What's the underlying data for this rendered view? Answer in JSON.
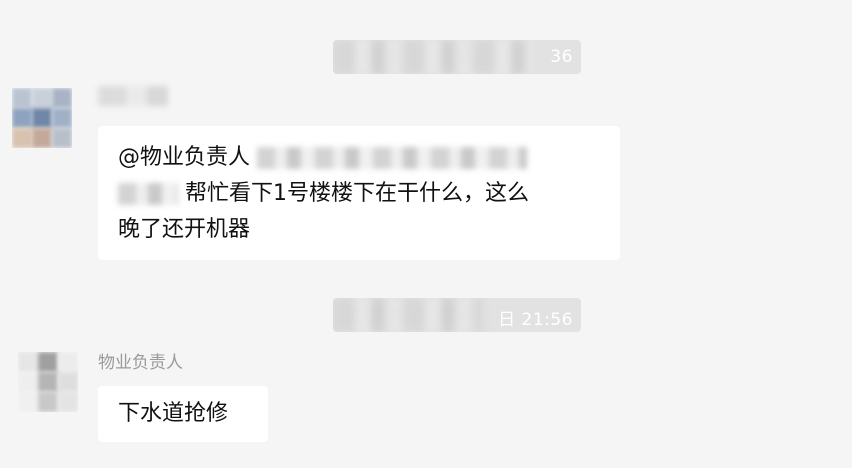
{
  "timestamps": [
    {
      "text": "36"
    },
    {
      "text": "日 21:56"
    }
  ],
  "messages": [
    {
      "sender": "",
      "line1_prefix": "@物业负责人",
      "line2_suffix": "帮忙看下1号楼楼下在干什么，这么",
      "line3": "晚了还开机器"
    },
    {
      "sender": "物业负责人",
      "text": "下水道抢修"
    }
  ],
  "colors": {
    "background": "#f5f5f5",
    "bubble": "#ffffff",
    "timestamp_bg": "#e2e2e2",
    "sender_name": "#9a9a9a"
  }
}
